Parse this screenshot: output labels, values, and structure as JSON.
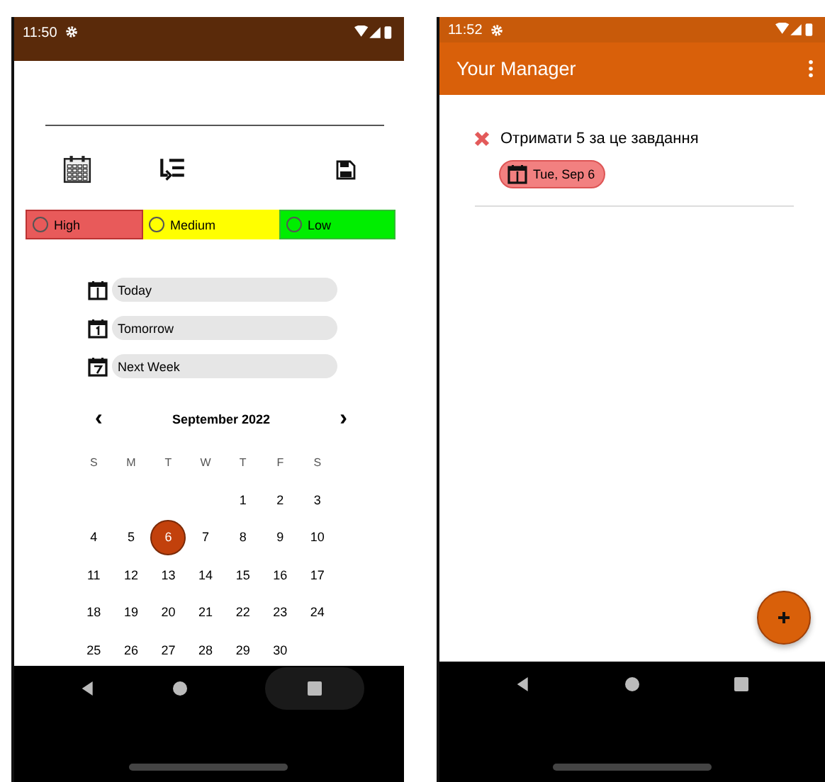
{
  "left_screen": {
    "status_bar": {
      "time": "11:50"
    },
    "priorities": [
      {
        "label": "High",
        "color": "#e85a5a",
        "selected": false
      },
      {
        "label": "Medium",
        "color": "#ffff00",
        "selected": false
      },
      {
        "label": "Low",
        "color": "#00ee00",
        "selected": false
      }
    ],
    "quick_dates": [
      {
        "label": "Today",
        "kind": "today"
      },
      {
        "label": "Tomorrow",
        "kind": "tomorrow"
      },
      {
        "label": "Next Week",
        "kind": "next_week"
      }
    ],
    "calendar": {
      "month": "September 2022",
      "prev": "‹",
      "next": "›",
      "weekdays": [
        "S",
        "M",
        "T",
        "W",
        "T",
        "F",
        "S"
      ],
      "weeks": [
        {
          "kind": "leading_gap",
          "days": [
            {
              "day": "1",
              "selected": false
            },
            {
              "day": "2",
              "selected": false
            },
            {
              "day": "3",
              "selected": false
            }
          ]
        },
        {
          "kind": "full",
          "days": [
            {
              "day": "4",
              "selected": false
            },
            {
              "day": "5",
              "selected": false
            },
            {
              "day": "6",
              "selected": true
            },
            {
              "day": "7",
              "selected": false
            },
            {
              "day": "8",
              "selected": false
            },
            {
              "day": "9",
              "selected": false
            },
            {
              "day": "10",
              "selected": false
            }
          ]
        },
        {
          "kind": "full",
          "days": [
            {
              "day": "11",
              "selected": false
            },
            {
              "day": "12",
              "selected": false
            },
            {
              "day": "13",
              "selected": false
            },
            {
              "day": "14",
              "selected": false
            },
            {
              "day": "15",
              "selected": false
            },
            {
              "day": "16",
              "selected": false
            },
            {
              "day": "17",
              "selected": false
            }
          ]
        },
        {
          "kind": "full",
          "days": [
            {
              "day": "18",
              "selected": false
            },
            {
              "day": "19",
              "selected": false
            },
            {
              "day": "20",
              "selected": false
            },
            {
              "day": "21",
              "selected": false
            },
            {
              "day": "22",
              "selected": false
            },
            {
              "day": "23",
              "selected": false
            },
            {
              "day": "24",
              "selected": false
            }
          ]
        },
        {
          "kind": "trailing_gap",
          "days": [
            {
              "day": "25",
              "selected": false
            },
            {
              "day": "26",
              "selected": false
            },
            {
              "day": "27",
              "selected": false
            },
            {
              "day": "28",
              "selected": false
            },
            {
              "day": "29",
              "selected": false
            },
            {
              "day": "30",
              "selected": false
            }
          ]
        }
      ]
    }
  },
  "right_screen": {
    "status_bar": {
      "time": "11:52"
    },
    "app_bar": {
      "title": "Your Manager"
    },
    "tasks": [
      {
        "title": "Отримати 5 за це завдання",
        "date": "Tue, Sep 6"
      }
    ]
  }
}
